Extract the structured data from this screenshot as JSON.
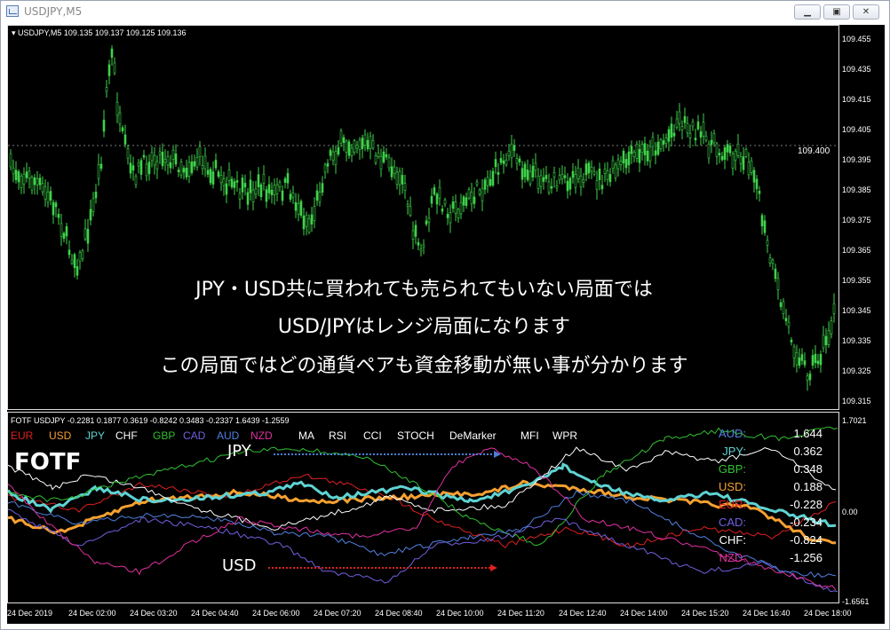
{
  "window": {
    "title": "USDJPY,M5",
    "icon": "chart-window-icon",
    "buttons": {
      "minimize": "minimize-icon",
      "maximize": "maximize-icon",
      "close": "close-icon"
    }
  },
  "main_chart": {
    "header": "USDJPY,M5  109.135 109.137 109.125 109.136",
    "price_labels": [
      "109.455",
      "109.435",
      "109.415",
      "109.405",
      "109.395",
      "109.385",
      "109.375",
      "109.365",
      "109.355",
      "109.345",
      "109.335",
      "109.325",
      "109.315"
    ],
    "level_line_label": "109.400",
    "candle_color": "#3fd24a",
    "overlay_text": [
      "JPY・USD共に買われても売られてもいない局面では",
      "USD/JPYはレンジ局面になります",
      "この局面ではどの通貨ペアも資金移動が無い事が分かります"
    ]
  },
  "indicator": {
    "header": "FOTF USDJPY -0.2281 0.1877 0.3619 -0.8242 0.3483 -0.2337 1.6439 -1.2559",
    "currencies": [
      {
        "name": "EUR",
        "color": "#e02020"
      },
      {
        "name": "USD",
        "color": "#f5a030"
      },
      {
        "name": "JPY",
        "color": "#5fd3d3"
      },
      {
        "name": "CHF",
        "color": "#ffffff"
      },
      {
        "name": "GBP",
        "color": "#30c030"
      },
      {
        "name": "CAD",
        "color": "#7060e0"
      },
      {
        "name": "AUD",
        "color": "#5080e0"
      },
      {
        "name": "NZD",
        "color": "#e030a0"
      }
    ],
    "menu": [
      "MA",
      "RSI",
      "CCI",
      "STOCH",
      "DeMarker",
      "MFI",
      "WPR"
    ],
    "logo": "FOTF",
    "annot_jpy": "JPY",
    "annot_usd": "USD",
    "annot_jpy_color": "#4a7fd8",
    "annot_usd_color": "#e02020",
    "axis_labels": [
      "1.7021",
      "0.00",
      "-1.6561"
    ],
    "strengths": [
      {
        "label": "AUD:",
        "value": "1.644",
        "color": "#5080e0"
      },
      {
        "label": "JPY:",
        "value": "0.362",
        "color": "#5fd3d3"
      },
      {
        "label": "GBP:",
        "value": "0.348",
        "color": "#30c030"
      },
      {
        "label": "USD:",
        "value": "0.188",
        "color": "#f5a030"
      },
      {
        "label": "EUR:",
        "value": "-0.228",
        "color": "#e02020"
      },
      {
        "label": "CAD:",
        "value": "-0.234",
        "color": "#7060e0"
      },
      {
        "label": "CHF:",
        "value": "-0.824",
        "color": "#ffffff"
      },
      {
        "label": "NZD:",
        "value": "-1.256",
        "color": "#e030a0"
      }
    ]
  },
  "time_axis": [
    "24 Dec 2019",
    "24 Dec 02:00",
    "24 Dec 03:20",
    "24 Dec 04:40",
    "24 Dec 06:00",
    "24 Dec 07:20",
    "24 Dec 08:40",
    "24 Dec 10:00",
    "24 Dec 11:20",
    "24 Dec 12:40",
    "24 Dec 14:00",
    "24 Dec 15:20",
    "24 Dec 16:40",
    "24 Dec 18:00"
  ]
}
